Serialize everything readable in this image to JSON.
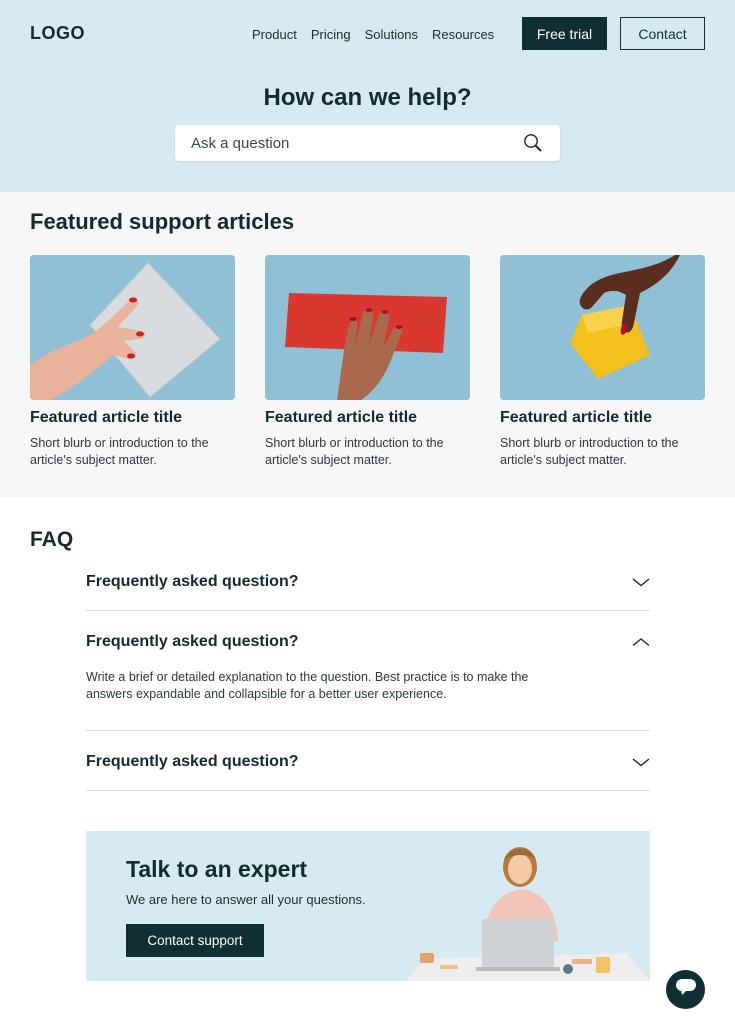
{
  "header": {
    "logo": "LOGO",
    "nav": [
      "Product",
      "Pricing",
      "Solutions",
      "Resources"
    ],
    "free_trial": "Free trial",
    "contact": "Contact"
  },
  "hero": {
    "title": "How can we help?",
    "search_placeholder": "Ask a question"
  },
  "featured": {
    "title": "Featured support articles",
    "cards": [
      {
        "title": "Featured article title",
        "blurb": "Short blurb or introduction to the article's subject matter."
      },
      {
        "title": "Featured article title",
        "blurb": "Short blurb or introduction to the article's subject matter."
      },
      {
        "title": "Featured article title",
        "blurb": "Short blurb or introduction to the article's subject matter."
      }
    ]
  },
  "faq": {
    "title": "FAQ",
    "items": [
      {
        "question": "Frequently asked question?",
        "expanded": false
      },
      {
        "question": "Frequently asked question?",
        "expanded": true,
        "answer": "Write a brief or detailed explanation to the question. Best practice is to make the answers expandable and collapsible for a better user experience."
      },
      {
        "question": "Frequently asked question?",
        "expanded": false
      }
    ]
  },
  "cta": {
    "title": "Talk to an expert",
    "subtitle": "We are here to answer all your questions.",
    "button": "Contact support"
  },
  "colors": {
    "hero_bg": "#d6ebf1",
    "primary": "#0f2f33",
    "card_bg": "#8fc0d5"
  },
  "icons": [
    "search-icon",
    "chevron-down-icon",
    "chevron-up-icon",
    "chat-icon"
  ]
}
